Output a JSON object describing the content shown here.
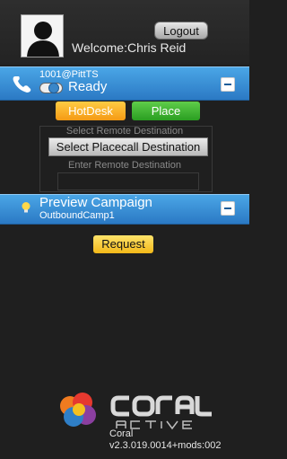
{
  "header": {
    "logout_label": "Logout",
    "welcome_text": "Welcome:Chris Reid"
  },
  "phone": {
    "extension": "1001@PittTS",
    "status": "Ready"
  },
  "buttons": {
    "hotdesk": "HotDesk",
    "place": "Place"
  },
  "destination": {
    "select_label": "Select Remote Destination",
    "placecall_button": "Select Placecall Destination",
    "enter_label": "Enter Remote Destination",
    "remote_value": ""
  },
  "campaign": {
    "title": "Preview Campaign",
    "name": "OutboundCamp1",
    "request_button": "Request"
  },
  "footer": {
    "product": "Coral",
    "version": "v2.3.019.0014+mods:002",
    "logo_word": "CORAL",
    "logo_sub": "ACTIVE"
  },
  "colors": {
    "bar_blue": "#2b79c4",
    "hotdesk_orange": "#f59a14",
    "place_green": "#2a9e21",
    "request_yellow": "#f2b819",
    "background": "#1f1f1f"
  },
  "icons": [
    "avatar-icon",
    "phone-icon",
    "toggle-switch",
    "collapse-icon",
    "lightbulb-icon",
    "coral-logo"
  ]
}
